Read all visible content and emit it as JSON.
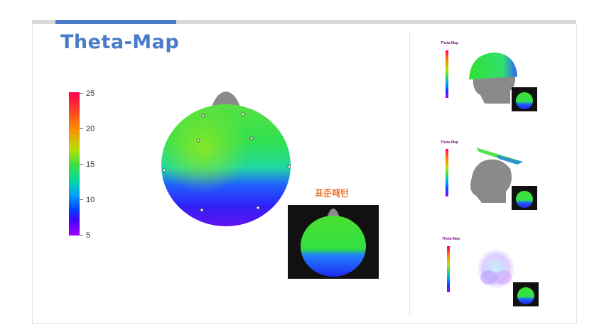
{
  "header": {
    "title": "Theta-Map"
  },
  "colorbar": {
    "ticks": [
      {
        "label": "25",
        "value": 25
      },
      {
        "label": "20",
        "value": 20
      },
      {
        "label": "15",
        "value": 15
      },
      {
        "label": "10",
        "value": 10
      },
      {
        "label": "5",
        "value": 5
      }
    ],
    "range": [
      5,
      25
    ]
  },
  "standard": {
    "label": "표준패턴"
  },
  "thumbnails": [
    {
      "title": "Theta-Map",
      "view": "side-helmet"
    },
    {
      "title": "Theta-Map",
      "view": "side-tilted-plane"
    },
    {
      "title": "Theta-Map",
      "view": "3d-top"
    }
  ],
  "colors": {
    "accent": "#4a7bc8",
    "standard_label": "#f07020",
    "divider": "#e2e2e2"
  }
}
